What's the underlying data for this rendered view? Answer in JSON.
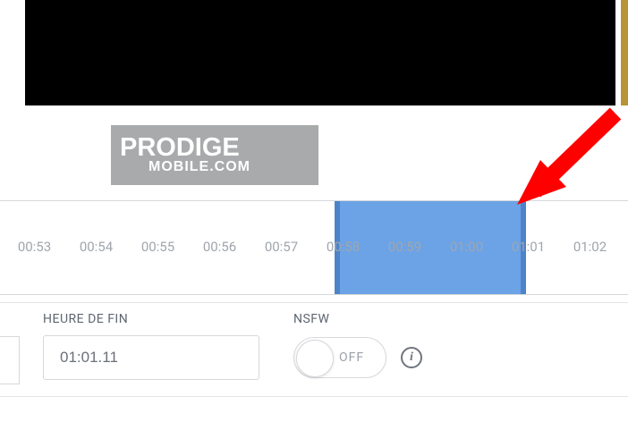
{
  "logo": {
    "line1": "PRODIGE",
    "line2": "MOBILE.COM"
  },
  "timeline": {
    "ticks": [
      "00:53",
      "00:54",
      "00:55",
      "00:56",
      "00:57",
      "00:58",
      "00:59",
      "01:00",
      "01:01",
      "01:02"
    ],
    "selection_start": "00:58",
    "selection_end": "01:01"
  },
  "fields": {
    "end_time_label": "HEURE DE FIN",
    "end_time_value": "01:01.11",
    "nsfw_label": "NSFW",
    "nsfw_toggle": "OFF"
  },
  "icons": {
    "info": "i"
  }
}
